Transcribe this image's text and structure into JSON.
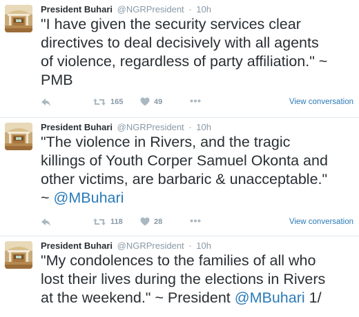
{
  "tweets": [
    {
      "name": "President Buhari",
      "handle": "@NGRPresident",
      "separator": "·",
      "time": "10h",
      "text": "\"I have given the security services clear\ndirectives to deal decisively with all agents\nof violence, regardless of party affiliation.\" ~\nPMB",
      "retweets": "165",
      "likes": "49",
      "view_conversation": "View conversation"
    },
    {
      "name": "President Buhari",
      "handle": "@NGRPresident",
      "separator": "·",
      "time": "10h",
      "text_before": "\"The violence in Rivers, and the tragic\nkillings of Youth Corper Samuel Okonta and\nother victims, are barbaric & unacceptable.\"\n~ ",
      "mention": "@MBuhari",
      "retweets": "118",
      "likes": "28",
      "view_conversation": "View conversation"
    },
    {
      "name": "President Buhari",
      "handle": "@NGRPresident",
      "separator": "·",
      "time": "10h",
      "text_before": "\"My condolences to the families of all who\nlost their lives during the elections in Rivers\nat the weekend.\" ~ President ",
      "mention": "@MBuhari",
      "text_after": " 1/"
    }
  ],
  "colors": {
    "link": "#2b7bb9",
    "muted": "#8899a6",
    "text": "#292f33",
    "divider": "#e1e8ed"
  },
  "icons": [
    "avatar-photo",
    "reply-icon",
    "retweet-icon",
    "heart-icon",
    "more-icon"
  ]
}
